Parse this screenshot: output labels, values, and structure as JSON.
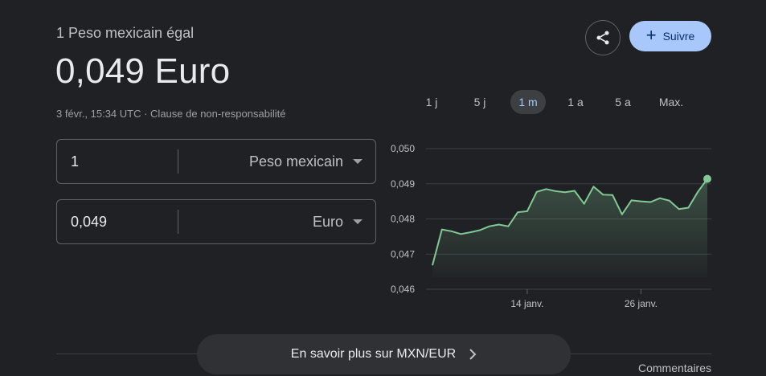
{
  "header": {
    "subtitle": "1 Peso mexicain égal",
    "value": "0,049 Euro",
    "timestamp": "3 févr., 15:34 UTC · ",
    "disclaimer": "Clause de non-responsabilité"
  },
  "actions": {
    "share_icon": "share-icon",
    "follow_label": "Suivre"
  },
  "range_tabs": [
    {
      "label": "1 j",
      "active": false
    },
    {
      "label": "5 j",
      "active": false
    },
    {
      "label": "1 m",
      "active": true
    },
    {
      "label": "1 a",
      "active": false
    },
    {
      "label": "5 a",
      "active": false
    },
    {
      "label": "Max.",
      "active": false
    }
  ],
  "converter": {
    "from": {
      "amount": "1",
      "currency": "Peso mexicain"
    },
    "to": {
      "amount": "0,049",
      "currency": "Euro"
    }
  },
  "chart_data": {
    "type": "area",
    "y_ticks": [
      "0,050",
      "0,049",
      "0,048",
      "0,047",
      "0,046"
    ],
    "ylim": [
      0.046,
      0.05
    ],
    "x_tick_labels": [
      {
        "label": "14 janv.",
        "index": 10
      },
      {
        "label": "26 janv.",
        "index": 22
      }
    ],
    "grid": true,
    "color": "#81c995",
    "values": [
      0.04668,
      0.0477,
      0.04765,
      0.04757,
      0.04762,
      0.04768,
      0.04779,
      0.04784,
      0.04779,
      0.04819,
      0.04822,
      0.04877,
      0.04885,
      0.04879,
      0.04876,
      0.0488,
      0.04843,
      0.04892,
      0.04869,
      0.04868,
      0.04813,
      0.04853,
      0.0485,
      0.04848,
      0.04859,
      0.04852,
      0.04828,
      0.04832,
      0.04877,
      0.04914
    ]
  },
  "footer": {
    "learn_more": "En savoir plus sur MXN/EUR",
    "feedback": "Commentaires"
  }
}
